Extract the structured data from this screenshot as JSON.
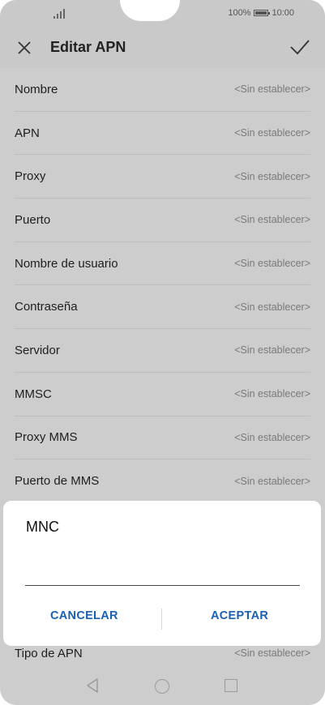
{
  "status_bar": {
    "battery": "100%",
    "time": "10:00"
  },
  "app_bar": {
    "title": "Editar APN"
  },
  "fields": [
    {
      "label": "Nombre",
      "value": "<Sin establecer>"
    },
    {
      "label": "APN",
      "value": "<Sin establecer>"
    },
    {
      "label": "Proxy",
      "value": "<Sin establecer>"
    },
    {
      "label": "Puerto",
      "value": "<Sin establecer>"
    },
    {
      "label": "Nombre de usuario",
      "value": "<Sin establecer>"
    },
    {
      "label": "Contraseña",
      "value": "<Sin establecer>"
    },
    {
      "label": "Servidor",
      "value": "<Sin establecer>"
    },
    {
      "label": "MMSC",
      "value": "<Sin establecer>"
    },
    {
      "label": "Proxy MMS",
      "value": "<Sin establecer>"
    },
    {
      "label": "Puerto de MMS",
      "value": "<Sin establecer>"
    }
  ],
  "dialog": {
    "title": "MNC",
    "input_value": "",
    "cancel_label": "CANCELAR",
    "accept_label": "ACEPTAR"
  },
  "last_field": {
    "label": "Tipo de APN",
    "value": "<Sin establecer>"
  },
  "colors": {
    "accent": "#1a5fb4",
    "dim_background": "#cdcdcd"
  }
}
